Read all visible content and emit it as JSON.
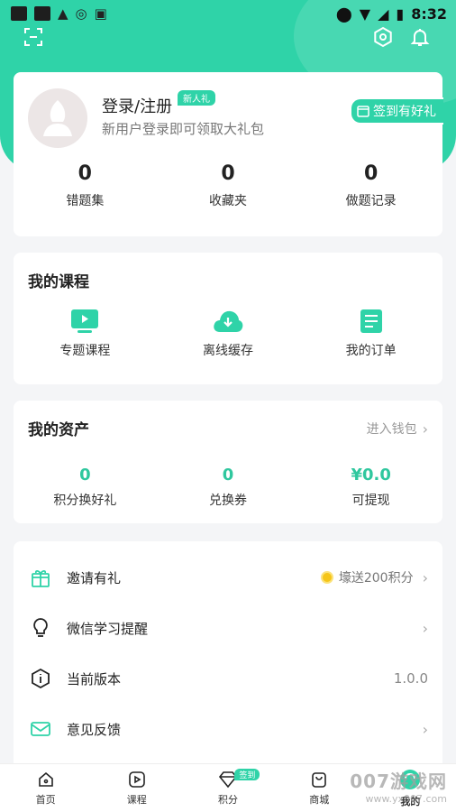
{
  "status_bar": {
    "time": "8:32"
  },
  "profile": {
    "title": "登录/注册",
    "badge": "新人礼",
    "subtitle": "新用户登录即可领取大礼包",
    "checkin_label": "签到有好礼",
    "stats": [
      {
        "value": "0",
        "label": "错题集"
      },
      {
        "value": "0",
        "label": "收藏夹"
      },
      {
        "value": "0",
        "label": "做题记录"
      }
    ]
  },
  "courses": {
    "title": "我的课程",
    "items": [
      {
        "label": "专题课程",
        "icon": "video-icon"
      },
      {
        "label": "离线缓存",
        "icon": "cloud-download-icon"
      },
      {
        "label": "我的订单",
        "icon": "document-icon"
      }
    ]
  },
  "assets": {
    "title": "我的资产",
    "wallet_link": "进入钱包",
    "items": [
      {
        "value": "0",
        "label": "积分换好礼"
      },
      {
        "value": "0",
        "label": "兑换券"
      },
      {
        "value": "¥0.0",
        "label": "可提现"
      }
    ]
  },
  "menu": [
    {
      "label": "邀请有礼",
      "extra": "壕送200积分",
      "icon": "gift-icon"
    },
    {
      "label": "微信学习提醒",
      "icon": "lightbulb-icon"
    },
    {
      "label": "当前版本",
      "version": "1.0.0",
      "icon": "info-icon"
    },
    {
      "label": "意见反馈",
      "icon": "mail-icon"
    }
  ],
  "tabbar": {
    "items": [
      {
        "label": "首页"
      },
      {
        "label": "课程"
      },
      {
        "label": "积分",
        "badge": "签到"
      },
      {
        "label": "商城"
      },
      {
        "label": "我的"
      }
    ]
  },
  "watermark": {
    "line1": "007游戏网",
    "line2": "www.yx007.com"
  },
  "colors": {
    "accent": "#2fd3a8",
    "asset_value": "#2fc79e",
    "background": "#f4f5f7"
  }
}
